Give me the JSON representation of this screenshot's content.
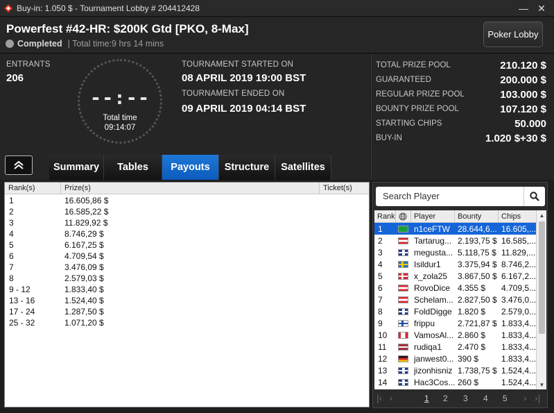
{
  "window": {
    "title": "Buy-in: 1.050 $ - Tournament Lobby # 204412428",
    "minimize": "—",
    "close": "✕"
  },
  "header": {
    "tournament_name": "Powerfest #42-HR: $200K Gtd [PKO, 8-Max]",
    "status": "Completed",
    "total_time": "| Total time:9 hrs  14 mins",
    "poker_lobby_button": "Poker Lobby"
  },
  "info": {
    "entrants_label": "ENTRANTS",
    "entrants_value": "206",
    "clock_digits": "--:--",
    "total_time_label": "Total time",
    "total_time_value": "09:14:07",
    "started_label": "TOURNAMENT STARTED ON",
    "started_value": "08 APRIL 2019  19:00 BST",
    "ended_label": "TOURNAMENT ENDED ON",
    "ended_value": "09 APRIL 2019  04:14 BST"
  },
  "prizes": [
    {
      "label": "TOTAL PRIZE POOL",
      "value": "210.120 $"
    },
    {
      "label": "GUARANTEED",
      "value": "200.000 $"
    },
    {
      "label": "REGULAR PRIZE POOL",
      "value": "103.000 $"
    },
    {
      "label": "BOUNTY PRIZE POOL",
      "value": "107.120 $"
    },
    {
      "label": "STARTING CHIPS",
      "value": "50.000"
    },
    {
      "label": "BUY-IN",
      "value": "1.020 $+30 $"
    }
  ],
  "tabs": [
    {
      "label": "Summary",
      "active": false
    },
    {
      "label": "Tables",
      "active": false
    },
    {
      "label": "Payouts",
      "active": true
    },
    {
      "label": "Structure",
      "active": false
    },
    {
      "label": "Satellites",
      "active": false
    }
  ],
  "payouts": {
    "headers": {
      "rank": "Rank(s)",
      "prize": "Prize(s)",
      "ticket": "Ticket(s)"
    },
    "rows": [
      {
        "rank": "1",
        "prize": "16.605,86 $"
      },
      {
        "rank": "2",
        "prize": "16.585,22 $"
      },
      {
        "rank": "3",
        "prize": "11.829,92 $"
      },
      {
        "rank": "4",
        "prize": "8.746,29 $"
      },
      {
        "rank": "5",
        "prize": "6.167,25 $"
      },
      {
        "rank": "6",
        "prize": "4.709,54 $"
      },
      {
        "rank": "7",
        "prize": "3.476,09 $"
      },
      {
        "rank": "8",
        "prize": "2.579,03 $"
      },
      {
        "rank": "9 - 12",
        "prize": "1.833,40 $"
      },
      {
        "rank": "13 - 16",
        "prize": "1.524,40 $"
      },
      {
        "rank": "17 - 24",
        "prize": "1.287,50 $"
      },
      {
        "rank": "25 - 32",
        "prize": "1.071,20 $"
      }
    ]
  },
  "players": {
    "search_placeholder": "Search Player",
    "headers": {
      "rank": "Rank",
      "player": "Player",
      "bounty": "Bounty",
      "chips": "Chips"
    },
    "rows": [
      {
        "rank": "1",
        "flag": "brazil",
        "name": "n1ceFTW",
        "bounty": "28.644,6...",
        "chips": "16.605,...",
        "selected": true
      },
      {
        "rank": "2",
        "flag": "austria",
        "name": "Tartarug...",
        "bounty": "2.193,75 $",
        "chips": "16.585,...",
        "selected": false
      },
      {
        "rank": "3",
        "flag": "uk",
        "name": "megusta...",
        "bounty": "5.118,75 $",
        "chips": "11.829,...",
        "selected": false
      },
      {
        "rank": "4",
        "flag": "sweden",
        "name": "Isildur1",
        "bounty": "3.375,94 $",
        "chips": "8.746,2...",
        "selected": false
      },
      {
        "rank": "5",
        "flag": "denmark",
        "name": "x_zola25",
        "bounty": "3.867,50 $",
        "chips": "6.167,2...",
        "selected": false
      },
      {
        "rank": "6",
        "flag": "austria",
        "name": "RovoDice",
        "bounty": "4.355 $",
        "chips": "4.709,5...",
        "selected": false
      },
      {
        "rank": "7",
        "flag": "austria",
        "name": "Schelam...",
        "bounty": "2.827,50 $",
        "chips": "3.476,0...",
        "selected": false
      },
      {
        "rank": "8",
        "flag": "uk",
        "name": "FoldDigge",
        "bounty": "1.820 $",
        "chips": "2.579,0...",
        "selected": false
      },
      {
        "rank": "9",
        "flag": "finland",
        "name": "frippu",
        "bounty": "2.721,87 $",
        "chips": "1.833,4...",
        "selected": false
      },
      {
        "rank": "10",
        "flag": "canada",
        "name": "VamosAl...",
        "bounty": "2.860 $",
        "chips": "1.833,4...",
        "selected": false
      },
      {
        "rank": "11",
        "flag": "latvia",
        "name": "rudiqa1",
        "bounty": "2.470 $",
        "chips": "1.833,4...",
        "selected": false
      },
      {
        "rank": "12",
        "flag": "germany",
        "name": "janwest0...",
        "bounty": "390 $",
        "chips": "1.833,4...",
        "selected": false
      },
      {
        "rank": "13",
        "flag": "uk",
        "name": "jizonhisniz",
        "bounty": "1.738,75 $",
        "chips": "1.524,4...",
        "selected": false
      },
      {
        "rank": "14",
        "flag": "uk",
        "name": "Hac3Cos...",
        "bounty": "260 $",
        "chips": "1.524,4...",
        "selected": false
      }
    ],
    "pages": [
      "1",
      "2",
      "3",
      "4",
      "5"
    ]
  }
}
